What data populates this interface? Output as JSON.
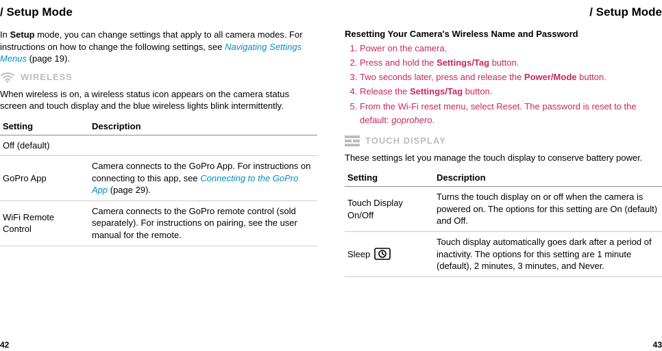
{
  "left": {
    "header": "/ Setup Mode",
    "intro_prefix": "In ",
    "intro_bold": "Setup",
    "intro_mid": " mode, you can change settings that apply to all camera modes. For instructions on how to change the following settings, see ",
    "intro_link": "Navigating Settings Menus",
    "intro_suffix": " (page 19).",
    "wireless_label": "WIRELESS",
    "wireless_desc": "When wireless is on, a wireless status icon appears on the camera status screen and touch display and the blue wireless lights blink intermittently.",
    "table": {
      "col1": "Setting",
      "col2": "Description",
      "rows": [
        {
          "setting": "Off (default)",
          "desc": ""
        },
        {
          "setting": "GoPro App",
          "desc_pre": "Camera connects to the GoPro App. For instructions on connecting to this app, see ",
          "desc_link": "Connecting to the GoPro App",
          "desc_post": " (page 29)."
        },
        {
          "setting": "WiFi Remote Control",
          "desc": "Camera connects to the GoPro remote control (sold separately). For instructions on pairing, see the user manual for the remote."
        }
      ]
    },
    "page_num": "42"
  },
  "right": {
    "header": "/ Setup Mode",
    "heading": "Resetting Your Camera's Wireless Name and Password",
    "steps": {
      "s1": "Power on the camera.",
      "s2_pre": "Press and hold the ",
      "s2_b": "Settings/Tag",
      "s2_post": " button.",
      "s3_pre": "Two seconds later, press and release the  ",
      "s3_b": "Power/Mode",
      "s3_post": " button.",
      "s4_pre": "Release the ",
      "s4_b": "Settings/Tag",
      "s4_post": " button.",
      "s5_pre": "From the Wi-Fi reset menu, select Reset. The password is reset to the default: ",
      "s5_i": "goprohero",
      "s5_post": "."
    },
    "touch_label": "TOUCH DISPLAY",
    "touch_desc": "These settings let you manage the touch display to conserve battery power.",
    "table": {
      "col1": "Setting",
      "col2": "Description",
      "rows": [
        {
          "setting": "Touch Display On/Off",
          "desc": "Turns the touch display on or off when the camera is powered on. The options for this setting are On (default) and Off."
        },
        {
          "setting": "Sleep",
          "desc": "Touch display automatically goes dark after a period of inactivity. The options for this setting are 1 minute (default), 2 minutes, 3 minutes, and Never."
        }
      ]
    },
    "page_num": "43"
  }
}
